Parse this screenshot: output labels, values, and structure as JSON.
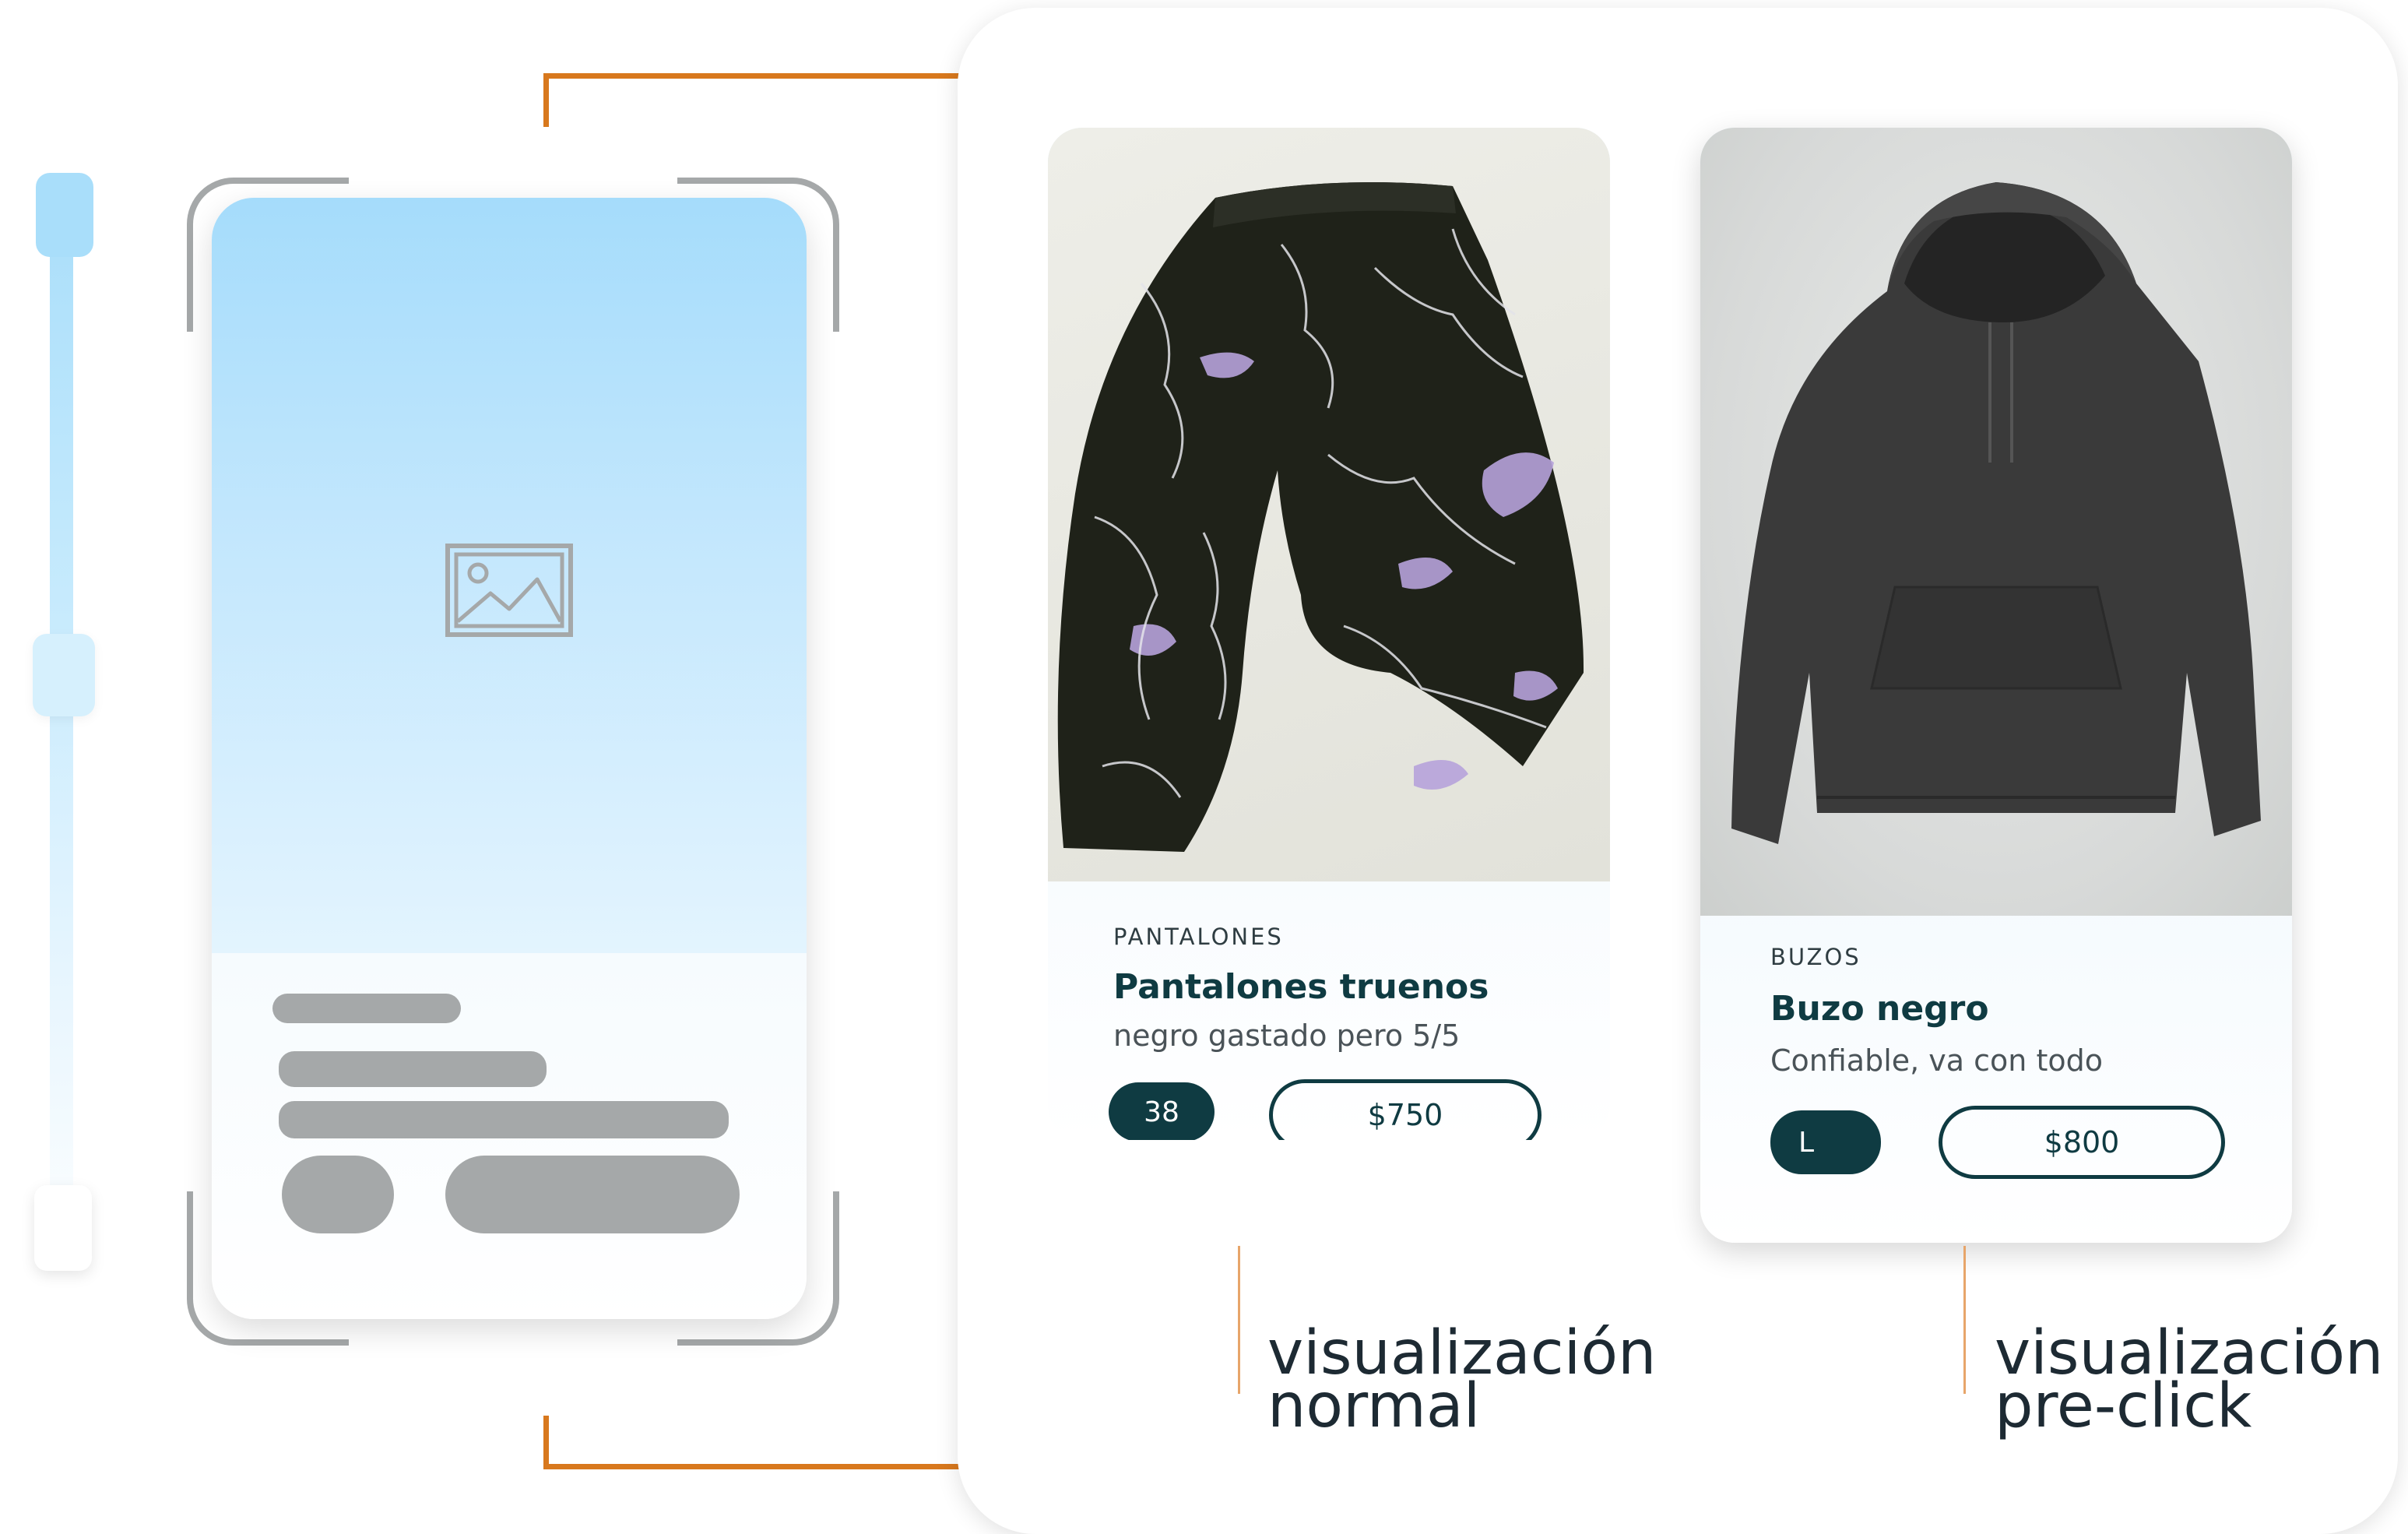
{
  "colors": {
    "accent_orange": "#d8781d",
    "brand_dark_teal": "#0f3b42",
    "wireframe_gray": "#a5a8a9",
    "skeleton_blue": "#a5dcfb"
  },
  "wireframe": {
    "image_icon": "image-placeholder-icon"
  },
  "cards": [
    {
      "category": "PANTALONES",
      "title": "Pantalones truenos",
      "description": "negro gastado pero 5/5",
      "size": "38",
      "price": "$750",
      "caption_line1": "visualización",
      "caption_line2": "normal"
    },
    {
      "category": "BUZOS",
      "title": "Buzo negro",
      "description": "Confiable, va con todo",
      "size": "L",
      "price": "$800",
      "caption_line1": "visualización",
      "caption_line2": "pre-click"
    }
  ]
}
